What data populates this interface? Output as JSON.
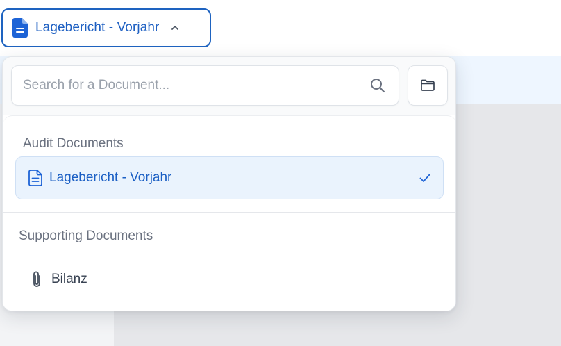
{
  "trigger": {
    "label": "Lagebericht - Vorjahr",
    "icon": "document-icon",
    "chevron": "chevron-up-icon"
  },
  "dropdown": {
    "search": {
      "placeholder": "Search for a Document...",
      "value": "",
      "icon": "search-icon"
    },
    "folder_button_icon": "folder-icon",
    "groups": [
      {
        "heading": "Audit Documents",
        "items": [
          {
            "label": "Lagebericht - Vorjahr",
            "icon": "document-icon",
            "selected": true
          }
        ]
      },
      {
        "heading": "Supporting Documents",
        "items": [
          {
            "label": "Bilanz",
            "icon": "paperclip-icon",
            "selected": false
          }
        ]
      }
    ]
  },
  "colors": {
    "accent": "#1b5fc4",
    "selected_bg": "#eaf3fd",
    "heading_text": "#6b7280"
  }
}
